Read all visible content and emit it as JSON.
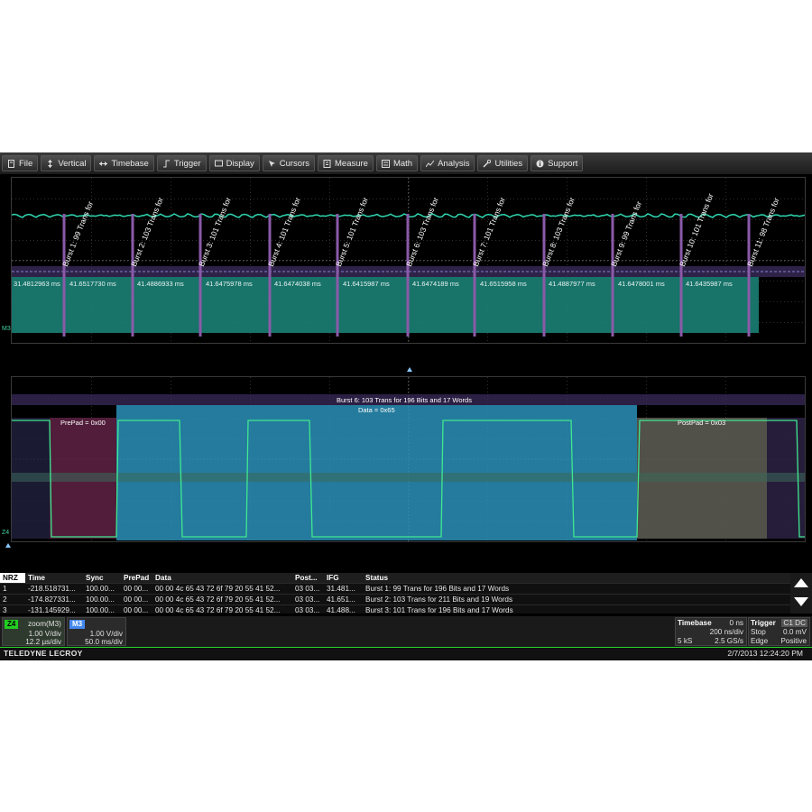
{
  "menu": {
    "items": [
      {
        "label": "File",
        "icon": "file-icon"
      },
      {
        "label": "Vertical",
        "icon": "vertical-arrows-icon"
      },
      {
        "label": "Timebase",
        "icon": "horizontal-arrows-icon"
      },
      {
        "label": "Trigger",
        "icon": "trigger-icon"
      },
      {
        "label": "Display",
        "icon": "display-icon"
      },
      {
        "label": "Cursors",
        "icon": "cursor-icon"
      },
      {
        "label": "Measure",
        "icon": "measure-icon"
      },
      {
        "label": "Math",
        "icon": "math-icon"
      },
      {
        "label": "Analysis",
        "icon": "analysis-icon"
      },
      {
        "label": "Utilities",
        "icon": "wrench-icon"
      },
      {
        "label": "Support",
        "icon": "info-icon"
      }
    ]
  },
  "top_grid": {
    "channel_marker": "M3",
    "bursts": [
      {
        "label": "Burst  1:  99 Trans for",
        "time": 0.066
      },
      {
        "label": "Burst  2: 103 Trans for",
        "time": 0.152
      },
      {
        "label": "Burst  3: 101 Trans for",
        "time": 0.238
      },
      {
        "label": "Burst  4: 101 Trans for",
        "time": 0.325
      },
      {
        "label": "Burst  5: 101 Trans for",
        "time": 0.411
      },
      {
        "label": "Burst  6: 103 Trans for",
        "time": 0.499
      },
      {
        "label": "Burst  7: 101 Trans for",
        "time": 0.584
      },
      {
        "label": "Burst  8: 103 Trans for",
        "time": 0.671
      },
      {
        "label": "Burst  9:  99 Trans for",
        "time": 0.758
      },
      {
        "label": "Burst 10: 101 Trans for",
        "time": 0.844
      },
      {
        "label": "Burst 11:  98 Trans for",
        "time": 0.93
      }
    ],
    "gaps": [
      {
        "label": "31.4812963 ms",
        "time": 0.0
      },
      {
        "label": "41.6517730 ms",
        "time": 0.07
      },
      {
        "label": "41.4886933 ms",
        "time": 0.156
      },
      {
        "label": "41.6475978 ms",
        "time": 0.242
      },
      {
        "label": "41.6474038 ms",
        "time": 0.329
      },
      {
        "label": "41.6415987 ms",
        "time": 0.415
      },
      {
        "label": "41.6474189 ms",
        "time": 0.503
      },
      {
        "label": "41.6515958 ms",
        "time": 0.588
      },
      {
        "label": "41.4887977 ms",
        "time": 0.675
      },
      {
        "label": "41.6478001 ms",
        "time": 0.762
      },
      {
        "label": "41.6435987 ms",
        "time": 0.848
      }
    ]
  },
  "bottom_grid": {
    "channel_marker": "Z4",
    "burst_title": "Burst  6: 103 Trans for 196 Bits and 17 Words",
    "data_label": "Data = 0x65",
    "prepad_label": "PrePad = 0x00",
    "postpad_label": "PostPad = 0x03",
    "colors": {
      "prepad": "#5a2040",
      "data": "#2a90b8",
      "postpad": "#5a5a52",
      "trace": "#40e890"
    }
  },
  "table": {
    "headers": [
      "NRZ",
      "Time",
      "Sync",
      "PrePad",
      "Data",
      "Post...",
      "IFG",
      "Status"
    ],
    "rows": [
      [
        "1",
        "-218.518731...",
        "100.00...",
        "00 00...",
        "00 00 4c 65 43 72 6f 79 20 55 41 52...",
        "03 03...",
        "31.481...",
        "Burst  1:  99 Trans for 196 Bits and 17 Words"
      ],
      [
        "2",
        "-174.827331...",
        "100.00...",
        "00 00...",
        "00 00 4c 65 43 72 6f 79 20 55 41 52...",
        "03 03...",
        "41.651...",
        "Burst  2: 103 Trans for 211 Bits and 19 Words"
      ],
      [
        "3",
        "-131.145929...",
        "100.00...",
        "00 00...",
        "00 00 4c 65 43 72 6f 79 20 55 41 52...",
        "03 03...",
        "41.488...",
        "Burst  3: 101 Trans for 196 Bits and 17 Words"
      ]
    ]
  },
  "status": {
    "z4": {
      "tag": "Z4",
      "title": "zoom(M3)",
      "line1": "1.00 V/div",
      "line2": "12.2 µs/div"
    },
    "m3": {
      "tag": "M3",
      "line1": "1.00 V/div",
      "line2": "50.0 ms/div"
    },
    "timebase": {
      "title": "Timebase",
      "offset": "0 ns",
      "rate": "200 ns/div",
      "samples": "5 kS",
      "srate": "2.5 GS/s"
    },
    "trigger": {
      "title": "Trigger",
      "tag": "C1 DC",
      "mode": "Stop",
      "level": "0.0 mV",
      "type": "Edge",
      "slope": "Positive"
    }
  },
  "footer": {
    "brand": "TELEDYNE LECROY",
    "datetime": "2/7/2013 12:24:20 PM"
  },
  "colors": {
    "trace": "#30d8b0",
    "band": "#1b7f74",
    "burst_marker": "#8a5aa8",
    "grid": "#3a3a3a",
    "z4_tag": "#22cc22",
    "m3_tag": "#4488ee"
  }
}
